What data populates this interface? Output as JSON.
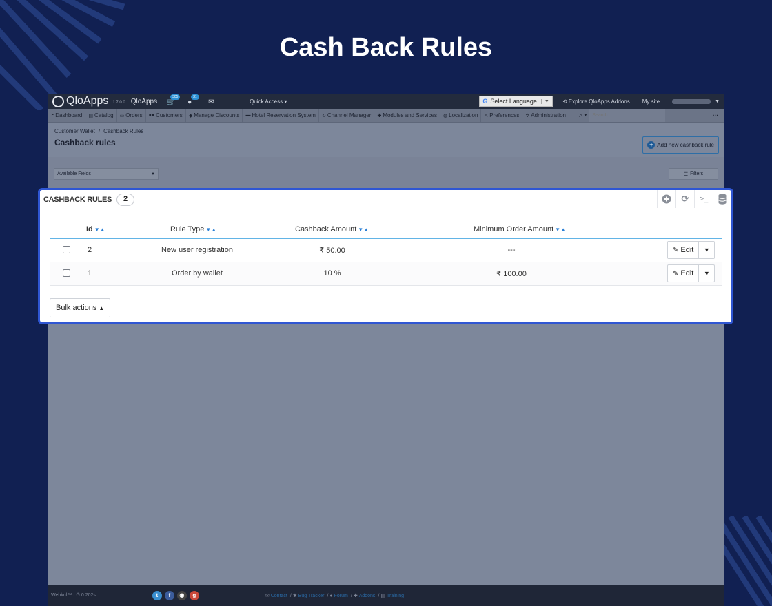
{
  "hero": {
    "title": "Cash Back Rules"
  },
  "topbar": {
    "brand_logo_text": "QloApps",
    "version": "1.7.0.0",
    "shop_name": "QloApps",
    "cart_count": "305",
    "customer_count": "31",
    "quick_access": "Quick Access",
    "select_language": "Select Language",
    "explore_addons": "Explore QloApps Addons",
    "my_site": "My site"
  },
  "nav": {
    "items": [
      {
        "label": "Dashboard",
        "icon": "dashboard-icon"
      },
      {
        "label": "Catalog",
        "icon": "book-icon"
      },
      {
        "label": "Orders",
        "icon": "orders-icon"
      },
      {
        "label": "Customers",
        "icon": "users-icon"
      },
      {
        "label": "Manage Discounts",
        "icon": "tag-icon"
      },
      {
        "label": "Hotel Reservation System",
        "icon": "bed-icon"
      },
      {
        "label": "Channel Manager",
        "icon": "refresh-icon"
      },
      {
        "label": "Modules and Services",
        "icon": "puzzle-icon"
      },
      {
        "label": "Localization",
        "icon": "globe-icon"
      },
      {
        "label": "Preferences",
        "icon": "wrench-icon"
      },
      {
        "label": "Administration",
        "icon": "gear-icon"
      }
    ],
    "search_placeholder": "Search",
    "more": "···"
  },
  "page": {
    "breadcrumb": [
      "Customer Wallet",
      "Cashback Rules"
    ],
    "title": "Cashback rules",
    "add_button": "Add new cashback rule",
    "available_fields": "Available Fields",
    "filters": "Filters"
  },
  "panel": {
    "title": "CASHBACK RULES",
    "count": "2",
    "tools": [
      "add-icon",
      "refresh-icon",
      "terminal-icon",
      "database-icon"
    ],
    "columns": [
      "Id",
      "Rule Type",
      "Cashback Amount",
      "Minimum Order Amount"
    ],
    "rows": [
      {
        "id": "2",
        "rule_type": "New user registration",
        "cashback_amount": "₹ 50.00",
        "min_order": "---"
      },
      {
        "id": "1",
        "rule_type": "Order by wallet",
        "cashback_amount": "10 %",
        "min_order": "₹ 100.00"
      }
    ],
    "edit_label": "Edit",
    "bulk_actions": "Bulk actions"
  },
  "footer": {
    "credit": "Webkul™ · ⏱ 0.202s",
    "links": [
      "Contact",
      "Bug Tracker",
      "Forum",
      "Addons",
      "Training"
    ]
  },
  "colors": {
    "background": "#112052",
    "highlight_border": "#2f56d3",
    "sort_arrow": "#2a7fd6",
    "header_rule": "#62b4e6"
  }
}
